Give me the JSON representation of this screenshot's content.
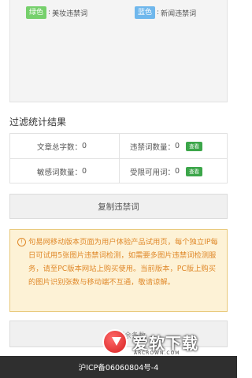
{
  "legend": {
    "green_label": "绿色",
    "green_desc": "美妆违禁词",
    "blue_label": "蓝色",
    "blue_desc": "新闻违禁词",
    "colors": {
      "green": "#76d06c",
      "blue": "#6fb7ec"
    }
  },
  "stats": {
    "title": "过滤统计结果",
    "total_chars_label": "文章总字数：",
    "total_chars_value": "0",
    "prohibited_label": "违禁词数量：",
    "prohibited_value": "0",
    "sensitive_label": "敏感词数量：",
    "sensitive_value": "0",
    "restricted_label": "受限可用词：",
    "restricted_value": "0",
    "view_label": "查看"
  },
  "copy_button": "复制违禁词",
  "notice": {
    "icon": "warning-icon",
    "text": "句易网移动版本页面为用户体验产品试用页，每个独立IP每日可试用5张图片违禁词检测，如需要多图片违禁词检测服务，请至PC版本网站上购买使用。当前版本，PC版上购买的图片识别张数与移动端不互通，敬请谅解。"
  },
  "partial_button": "剩余条数",
  "watermark": {
    "text": "爱软下载",
    "sub": "ARCROWN.COM"
  },
  "footer": "沪ICP备06060804号-4"
}
